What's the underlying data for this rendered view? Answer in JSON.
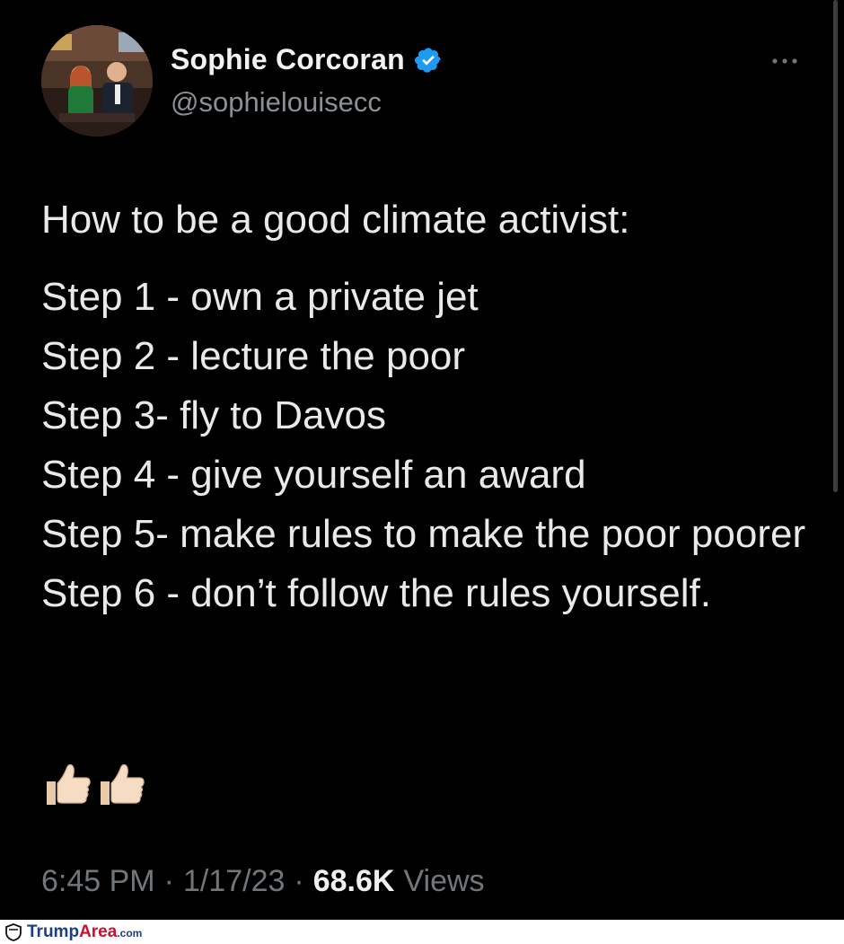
{
  "author": {
    "name": "Sophie Corcoran",
    "handle": "@sophielouisecc",
    "verified": true,
    "avatar_icon": "avatar-photo"
  },
  "tweet": {
    "intro": "How to be a good climate activist:",
    "lines": [
      "Step 1 - own a private jet",
      "Step 2 - lecture the poor",
      "Step 3- fly to Davos",
      "Step 4 - give yourself an award",
      "Step 5- make rules to make the poor poorer",
      "Step 6 - don’t follow the rules yourself."
    ],
    "emojis": "👍🏻👍🏻"
  },
  "meta": {
    "time": "6:45 PM",
    "date": "1/17/23",
    "views_count": "68.6K",
    "views_label": "Views",
    "separator": "·"
  },
  "footer": {
    "brand_part1": "Trump",
    "brand_part2": "Area",
    "brand_domain": ".com"
  },
  "colors": {
    "background": "#000000",
    "text": "#e7e9ea",
    "secondary": "#71767b",
    "verified": "#1d9bf0"
  }
}
